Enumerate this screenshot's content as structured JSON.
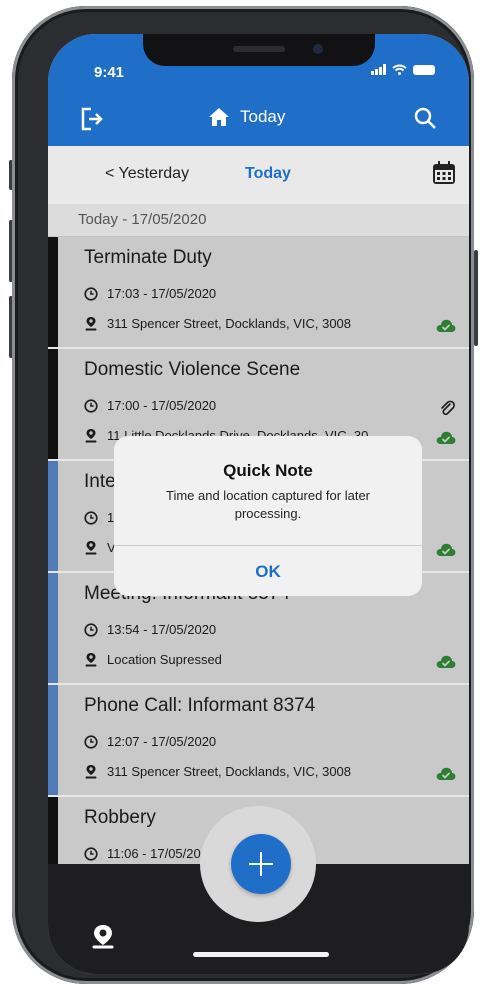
{
  "status": {
    "time": "9:41"
  },
  "header": {
    "title": "Today"
  },
  "daynav": {
    "prev_label": "< Yesterday",
    "current_label": "Today"
  },
  "section": {
    "date_label": "Today - 17/05/2020"
  },
  "events": [
    {
      "title": "Terminate Duty",
      "time": "17:03 - 17/05/2020",
      "location": "311 Spencer Street, Docklands, VIC, 3008",
      "bar": "black",
      "synced": true
    },
    {
      "title": "Domestic Violence Scene",
      "time": "17:00 - 17/05/2020",
      "location": "11 Little Docklands Drive, Docklands, VIC, 30",
      "bar": "black",
      "synced": true,
      "attachment": true
    },
    {
      "title": "Inte",
      "time": "1",
      "location": "V",
      "bar": "blue",
      "synced": true
    },
    {
      "title": "Meeting: Informant 8374",
      "time": "13:54 - 17/05/2020",
      "location": "Location Supressed",
      "bar": "blue",
      "synced": true
    },
    {
      "title": "Phone Call: Informant 8374",
      "time": "12:07 - 17/05/2020",
      "location": "311 Spencer Street, Docklands, VIC, 3008",
      "bar": "blue",
      "synced": true
    },
    {
      "title": "Robbery",
      "time": "11:06 - 17/05/20",
      "location": "",
      "bar": "black",
      "synced": false
    }
  ],
  "dialog": {
    "title": "Quick Note",
    "message": "Time and location captured for later processing.",
    "ok_label": "OK"
  },
  "colors": {
    "primary": "#1f6fc8",
    "synced": "#2e7d32",
    "bar_black": "#111111",
    "bar_blue": "#4f7bb6"
  },
  "icons": [
    "logout-icon",
    "home-icon",
    "search-icon",
    "calendar-icon",
    "clock-icon",
    "location-pin-icon",
    "cloud-check-icon",
    "paperclip-icon",
    "plus-icon"
  ]
}
